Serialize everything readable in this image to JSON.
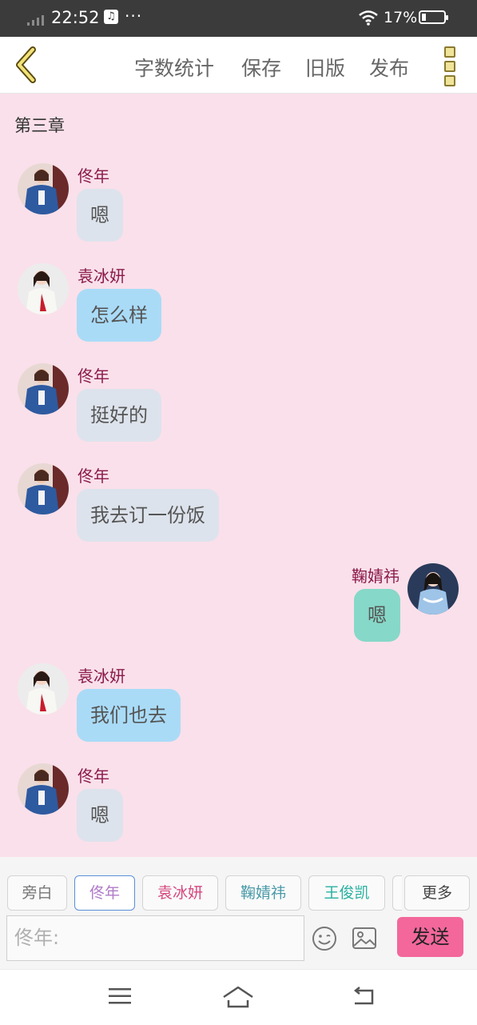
{
  "status_bar": {
    "time": "22:52",
    "more_indicator": "···",
    "battery_percent": "17%",
    "icons": [
      "signal-icon",
      "music-icon",
      "wifi-icon",
      "battery-icon"
    ]
  },
  "toolbar": {
    "back_icon": "chevron-left-icon",
    "word_count_label": "字数统计",
    "save_label": "保存",
    "old_version_label": "旧版",
    "publish_label": "发布",
    "more_icon": "more-vertical-icon"
  },
  "chat": {
    "chapter_title": "第三章",
    "messages": [
      {
        "speaker": "佟年",
        "text": "嗯",
        "side": "left"
      },
      {
        "speaker": "袁冰妍",
        "text": "怎么样",
        "side": "left"
      },
      {
        "speaker": "佟年",
        "text": "挺好的",
        "side": "left"
      },
      {
        "speaker": "佟年",
        "text": "我去订一份饭",
        "side": "left"
      },
      {
        "speaker": "鞠婧祎",
        "text": "嗯",
        "side": "right"
      },
      {
        "speaker": "袁冰妍",
        "text": "我们也去",
        "side": "left"
      },
      {
        "speaker": "佟年",
        "text": "嗯",
        "side": "left"
      }
    ]
  },
  "roles": {
    "items": [
      {
        "label": "旁白",
        "color": "#777777"
      },
      {
        "label": "佟年",
        "color": "#b07ac8",
        "active": true
      },
      {
        "label": "袁冰妍",
        "color": "#d6477e"
      },
      {
        "label": "鞠婧祎",
        "color": "#4a9aa8"
      },
      {
        "label": "王俊凯",
        "color": "#28b0a0"
      }
    ],
    "more_label": "更多"
  },
  "composer": {
    "input_placeholder": "佟年:",
    "send_label": "发送",
    "emoji_icon": "emoji-smile-icon",
    "image_icon": "image-icon"
  },
  "navbar": {
    "icons": [
      "menu-icon",
      "home-icon",
      "back-icon"
    ]
  },
  "colors": {
    "chat_background": "#fae0ea",
    "name_color": "#8a1a4a",
    "send_button": "#f3679b"
  }
}
